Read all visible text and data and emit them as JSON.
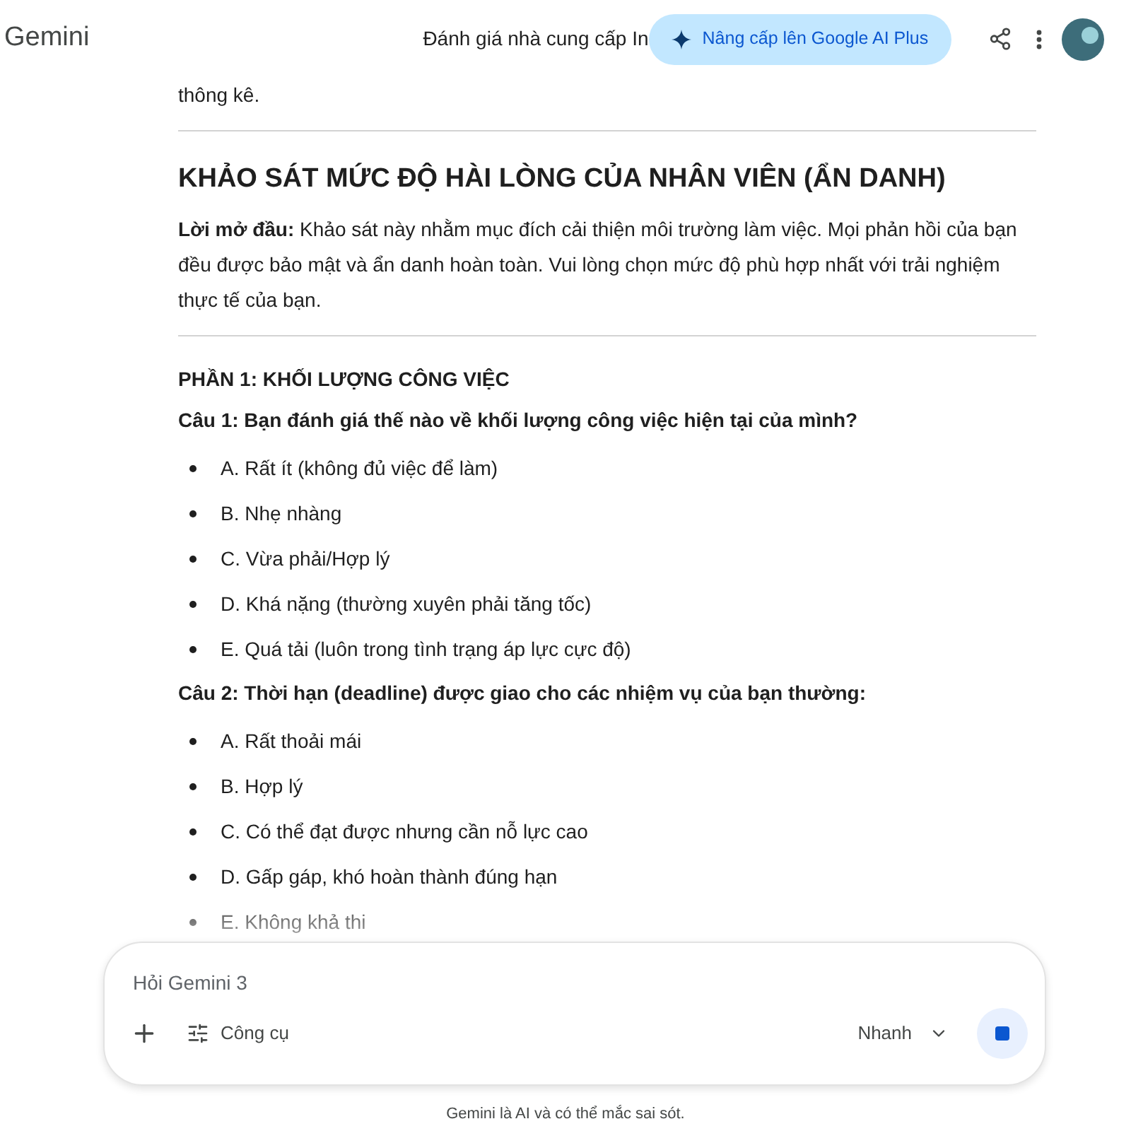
{
  "app_name": "Gemini",
  "chat_title": "Đánh giá nhà cung cấp In",
  "upgrade_button": "Nâng cấp lên Google AI Plus",
  "content": [
    {
      "kind": "paragraph",
      "text": "thông kê."
    },
    {
      "kind": "rule"
    },
    {
      "kind": "heading",
      "text": "KHẢO SÁT MỨC ĐỘ HÀI LÒNG CỦA NHÂN VIÊN (ẨN DANH)"
    },
    {
      "kind": "paragraph",
      "text": "**Lời mở đầu:** Khảo sát này nhằm mục đích cải thiện môi trường làm việc. Mọi phản hồi của bạn đều được bảo mật và ẩn danh hoàn toàn. Vui lòng chọn mức độ phù hợp nhất với trải nghiệm thực tế của bạn."
    },
    {
      "kind": "rule"
    },
    {
      "kind": "subheading",
      "text": "PHẦN 1: KHỐI LƯỢNG CÔNG VIỆC"
    },
    {
      "kind": "question",
      "text": "Câu 1: Bạn đánh giá thế nào về khối lượng công việc hiện tại của mình?"
    },
    {
      "kind": "list",
      "items": [
        "A. Rất ít (không đủ việc để làm)",
        "B. Nhẹ nhàng",
        "C. Vừa phải/Hợp lý",
        "D. Khá nặng (thường xuyên phải tăng tốc)",
        "E. Quá tải (luôn trong tình trạng áp lực cực độ)"
      ]
    },
    {
      "kind": "question",
      "text": "Câu 2: Thời hạn (deadline) được giao cho các nhiệm vụ của bạn thường:"
    },
    {
      "kind": "list",
      "items": [
        "A. Rất thoải mái",
        "B. Hợp lý",
        "C. Có thể đạt được nhưng cần nỗ lực cao",
        "D. Gấp gáp, khó hoàn thành đúng hạn",
        "E. Không khả thi"
      ]
    }
  ],
  "prompt": {
    "placeholder": "Hỏi Gemini 3",
    "tools_button": "Công cụ",
    "mode": "Nhanh"
  },
  "disclaimer": "Gemini là AI và có thể mắc sai sót."
}
